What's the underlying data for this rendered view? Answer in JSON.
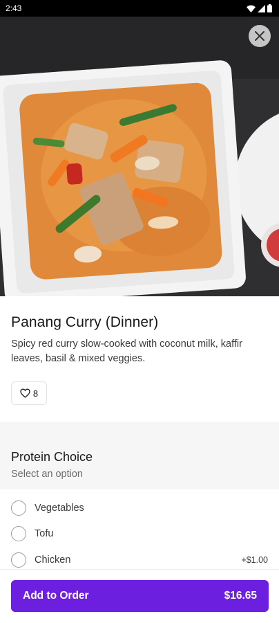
{
  "status_bar": {
    "time": "2:43"
  },
  "item": {
    "name": "Panang Curry (Dinner)",
    "description": "Spicy red curry slow-cooked with coconut milk, kaffir leaves, basil & mixed veggies.",
    "likes": "8"
  },
  "protein": {
    "title": "Protein Choice",
    "subtitle": "Select an option",
    "options": [
      {
        "label": "Vegetables",
        "price": ""
      },
      {
        "label": "Tofu",
        "price": ""
      },
      {
        "label": "Chicken",
        "price": "+$1.00"
      }
    ]
  },
  "cta": {
    "label": "Add to Order",
    "price": "$16.65"
  },
  "colors": {
    "accent": "#6d1fe0",
    "curry": "#e0893a",
    "background_band": "#f6f6f6"
  },
  "icons": [
    "wifi-icon",
    "signal-icon",
    "battery-icon",
    "close-icon",
    "heart-icon"
  ]
}
